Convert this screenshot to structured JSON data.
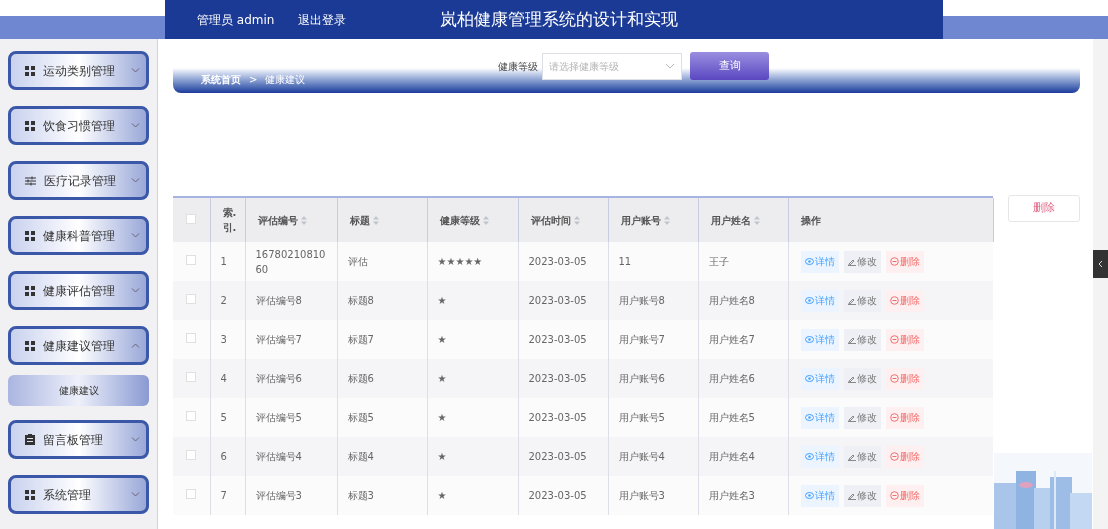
{
  "header": {
    "user_label": "管理员 admin",
    "logout": "退出登录",
    "title": "岚柏健康管理系统的设计和实现"
  },
  "sidebar": {
    "items": [
      {
        "label": "运动类别管理",
        "kind": "grid",
        "expanded": false
      },
      {
        "label": "饮食习惯管理",
        "kind": "grid",
        "expanded": false
      },
      {
        "label": "医疗记录管理",
        "kind": "sliders",
        "expanded": false
      },
      {
        "label": "健康科普管理",
        "kind": "grid",
        "expanded": false
      },
      {
        "label": "健康评估管理",
        "kind": "grid",
        "expanded": false
      },
      {
        "label": "健康建议管理",
        "kind": "grid",
        "expanded": true,
        "children": [
          {
            "label": "健康建议"
          }
        ]
      },
      {
        "label": "留言板管理",
        "kind": "clipboard",
        "expanded": false
      },
      {
        "label": "系统管理",
        "kind": "grid",
        "expanded": false
      }
    ]
  },
  "search": {
    "label": "健康等级",
    "placeholder": "请选择健康等级",
    "button": "查询"
  },
  "breadcrumb": {
    "home": "系统首页",
    "separator": ">",
    "current": "健康建议"
  },
  "batch_delete": "删除",
  "table": {
    "select_all_checked": false,
    "columns": [
      {
        "label": "索.\n引.",
        "sortable": false
      },
      {
        "label": "评估编号",
        "sortable": true
      },
      {
        "label": "标题",
        "sortable": true
      },
      {
        "label": "健康等级",
        "sortable": true
      },
      {
        "label": "评估时间",
        "sortable": true
      },
      {
        "label": "用户账号",
        "sortable": true
      },
      {
        "label": "用户姓名",
        "sortable": true
      },
      {
        "label": "操作",
        "sortable": false
      }
    ],
    "rows": [
      {
        "checked": false,
        "index": "1",
        "code": "1678021081060",
        "title": "评估",
        "rating": "★★★★★",
        "time": "2023-03-05",
        "account": "11",
        "name": "王子",
        "actions": [
          "详情",
          "修改",
          "删除"
        ]
      },
      {
        "checked": false,
        "index": "2",
        "code": "评估编号8",
        "title": "标题8",
        "rating": "★",
        "time": "2023-03-05",
        "account": "用户账号8",
        "name": "用户姓名8",
        "actions": [
          "详情",
          "修改",
          "删除"
        ]
      },
      {
        "checked": false,
        "index": "3",
        "code": "评估编号7",
        "title": "标题7",
        "rating": "★",
        "time": "2023-03-05",
        "account": "用户账号7",
        "name": "用户姓名7",
        "actions": [
          "详情",
          "修改",
          "删除"
        ]
      },
      {
        "checked": false,
        "index": "4",
        "code": "评估编号6",
        "title": "标题6",
        "rating": "★",
        "time": "2023-03-05",
        "account": "用户账号6",
        "name": "用户姓名6",
        "actions": [
          "详情",
          "修改",
          "删除"
        ]
      },
      {
        "checked": false,
        "index": "5",
        "code": "评估编号5",
        "title": "标题5",
        "rating": "★",
        "time": "2023-03-05",
        "account": "用户账号5",
        "name": "用户姓名5",
        "actions": [
          "详情",
          "修改",
          "删除"
        ]
      },
      {
        "checked": false,
        "index": "6",
        "code": "评估编号4",
        "title": "标题4",
        "rating": "★",
        "time": "2023-03-05",
        "account": "用户账号4",
        "name": "用户姓名4",
        "actions": [
          "详情",
          "修改",
          "删除"
        ]
      },
      {
        "checked": false,
        "index": "7",
        "code": "评估编号3",
        "title": "标题3",
        "rating": "★",
        "time": "2023-03-05",
        "account": "用户账号3",
        "name": "用户姓名3",
        "actions": [
          "详情",
          "修改",
          "删除"
        ]
      }
    ]
  }
}
